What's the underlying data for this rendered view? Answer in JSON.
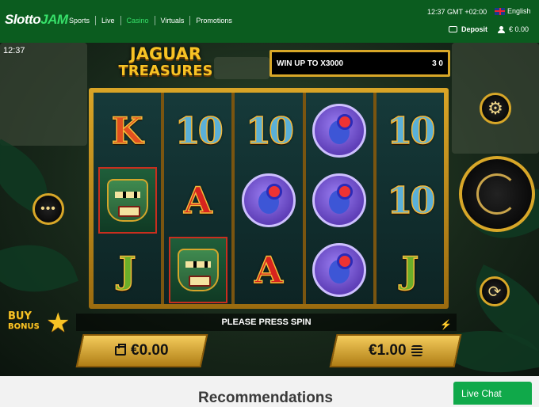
{
  "header": {
    "logo": "SlottoJAM",
    "nav": [
      {
        "label": "Sports",
        "active": false
      },
      {
        "label": "Live",
        "active": false
      },
      {
        "label": "Casino",
        "active": true
      },
      {
        "label": "Virtuals",
        "active": false
      },
      {
        "label": "Promotions",
        "active": false
      }
    ],
    "clock": "12:37  GMT +02:00",
    "language": "English",
    "deposit_label": "Deposit",
    "balance": "€ 0.00",
    "accent_color": "#37e06a",
    "bg_color": "#0b5c1f"
  },
  "game": {
    "time": "12:37",
    "logo_line1": "JAGUAR",
    "logo_line2": "TREASURES",
    "win_text": "WIN UP TO X3000",
    "win_amount": "3 0",
    "reels": [
      [
        "K",
        "mask",
        "J"
      ],
      [
        "10",
        "A",
        "mask"
      ],
      [
        "10",
        "frog",
        "A"
      ],
      [
        "frog",
        "frog",
        "frog"
      ],
      [
        "10",
        "10",
        "J"
      ]
    ],
    "status": "PLEASE PRESS SPIN",
    "buy_bonus_line1": "BUY",
    "buy_bonus_line2": "BONUS",
    "balance_value": "€0.00",
    "bet_value": "€1.00",
    "icons": [
      "settings-gear-icon",
      "menu-dots-icon",
      "spin-icon",
      "autoplay-icon",
      "bolt-icon",
      "bag-icon",
      "coins-icon",
      "star-icon"
    ]
  },
  "page": {
    "recommendations": "Recommendations",
    "live_chat": "Live Chat"
  }
}
